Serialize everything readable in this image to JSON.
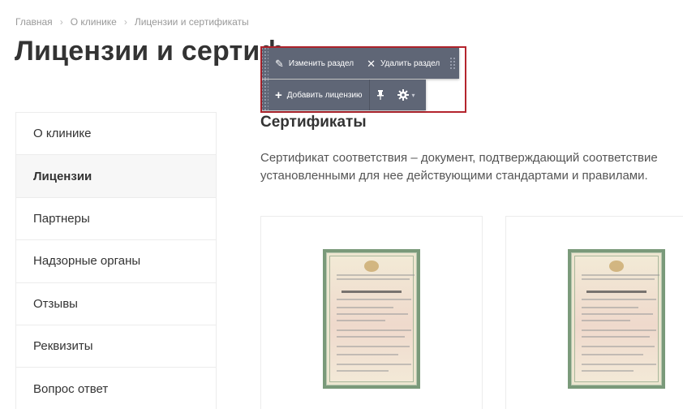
{
  "breadcrumbs": [
    {
      "label": "Главная"
    },
    {
      "label": "О клинике"
    },
    {
      "label": "Лицензии и сертификаты"
    }
  ],
  "page": {
    "title_visible": "Лицензии и сертиф"
  },
  "sidebar": {
    "items": [
      {
        "label": "О клинике",
        "active": false
      },
      {
        "label": "Лицензии",
        "active": true
      },
      {
        "label": "Партнеры",
        "active": false
      },
      {
        "label": "Надзорные органы",
        "active": false
      },
      {
        "label": "Отзывы",
        "active": false
      },
      {
        "label": "Реквизиты",
        "active": false
      },
      {
        "label": "Вопрос ответ",
        "active": false
      }
    ]
  },
  "section": {
    "title": "Сертификаты",
    "description": "Сертификат соответствия – документ, подтверждающий соответствие установленными для нее действующими стандартами и правилами."
  },
  "edit_toolbar": {
    "edit_section_label": "Изменить раздел",
    "delete_section_label": "Удалить раздел",
    "add_license_label": "Добавить лицензию",
    "icons": {
      "edit": "pencil-icon",
      "delete": "close-icon",
      "add": "plus-icon",
      "pin": "pin-icon",
      "settings": "gear-icon",
      "more": "chevron-down-icon"
    }
  },
  "colors": {
    "toolbar_bg": "#5f6676",
    "highlight_border": "#b4242d",
    "active_item_bg": "#f7f7f7"
  }
}
